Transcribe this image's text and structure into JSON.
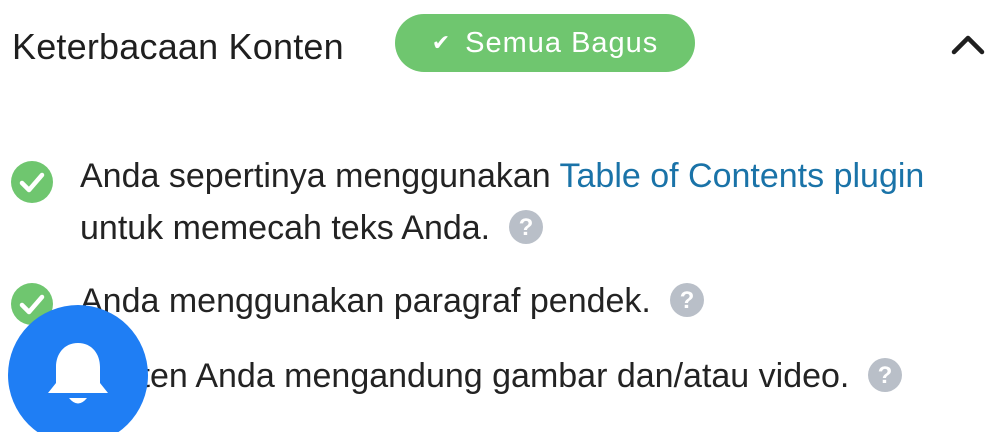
{
  "header": {
    "title": "Keterbacaan Konten",
    "badge_check": "✔",
    "badge_label": "Semua Bagus"
  },
  "items": [
    {
      "text_before": "Anda sepertinya menggunakan ",
      "link_text": "Table of Contents plugin",
      "text_after": " untuk memecah teks Anda."
    },
    {
      "text": "Anda menggunakan paragraf pendek."
    },
    {
      "text": "Konten Anda mengandung gambar dan/atau video."
    }
  ],
  "colors": {
    "success_green": "#6fc66f",
    "help_gray": "#b9bfc8",
    "link_blue": "#1a73a8",
    "fab_blue": "#1f7ef4"
  },
  "icons": {
    "collapse": "chevron-up-icon",
    "item_status": "check-circle-icon",
    "help": "question-circle-icon",
    "fab": "bell-icon"
  }
}
